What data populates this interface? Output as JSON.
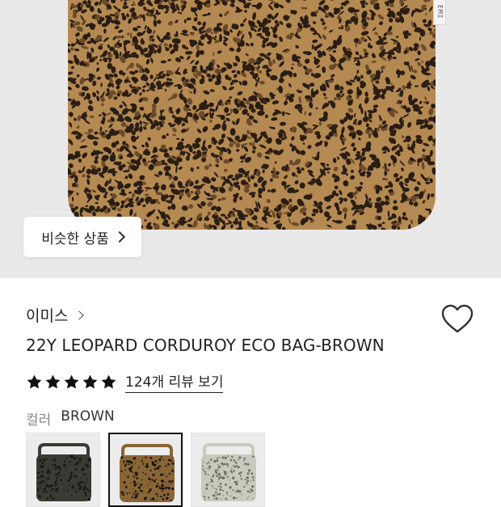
{
  "hero": {
    "tag_text": "EMI",
    "similar_button_label": "비슷한 상품"
  },
  "product": {
    "brand": "이미스",
    "title": "22Y LEOPARD CORDUROY ECO BAG-BROWN",
    "rating_stars": 5,
    "reviews_link": "124개 리뷰 보기"
  },
  "color": {
    "label": "컬러",
    "selected_value": "BROWN",
    "options": [
      {
        "name": "black-leopard",
        "color": "#3b3b36",
        "selected": false
      },
      {
        "name": "brown-leopard",
        "color": "#8a6536",
        "selected": true
      },
      {
        "name": "ivory-leopard",
        "color": "#c9cabd",
        "selected": false
      }
    ]
  },
  "colors": {
    "hero_bg": "#e9e9e9",
    "leopard_base": "#b58a52",
    "leopard_spot": "#2a1e14",
    "star": "#111111"
  }
}
